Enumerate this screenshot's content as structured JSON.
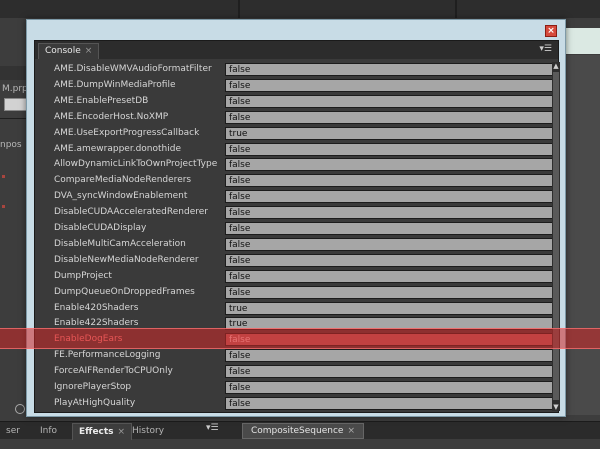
{
  "background": {
    "left_fragments": [
      "M.prp",
      "npos"
    ],
    "bottom_tabs": [
      {
        "label": "ser",
        "active": false
      },
      {
        "label": "Info",
        "active": false
      },
      {
        "label": "Effects",
        "active": true,
        "close": "×"
      },
      {
        "label": "History",
        "active": false
      }
    ],
    "bottom_menu_glyph": "▾☰",
    "sequence_tab": {
      "label": "CompositeSequence",
      "close": "×"
    }
  },
  "dialog": {
    "close_glyph": "×",
    "console": {
      "tab_label": "Console",
      "tab_close": "×",
      "menu_glyph": "▾☰",
      "rows": [
        {
          "name": "AME.DisableWMVAudioFormatFilter",
          "value": "false"
        },
        {
          "name": "AME.DumpWinMediaProfile",
          "value": "false"
        },
        {
          "name": "AME.EnablePresetDB",
          "value": "false"
        },
        {
          "name": "AME.EncoderHost.NoXMP",
          "value": "false"
        },
        {
          "name": "AME.UseExportProgressCallback",
          "value": "true"
        },
        {
          "name": "AME.amewrapper.donothide",
          "value": "false"
        },
        {
          "name": "AllowDynamicLinkToOwnProjectType",
          "value": "false"
        },
        {
          "name": "CompareMediaNodeRenderers",
          "value": "false"
        },
        {
          "name": "DVA_syncWindowEnablement",
          "value": "false"
        },
        {
          "name": "DisableCUDAAcceleratedRenderer",
          "value": "false"
        },
        {
          "name": "DisableCUDADisplay",
          "value": "false"
        },
        {
          "name": "DisableMultiCamAcceleration",
          "value": "false"
        },
        {
          "name": "DisableNewMediaNodeRenderer",
          "value": "false"
        },
        {
          "name": "DumpProject",
          "value": "false"
        },
        {
          "name": "DumpQueueOnDroppedFrames",
          "value": "false"
        },
        {
          "name": "Enable420Shaders",
          "value": "true"
        },
        {
          "name": "Enable422Shaders",
          "value": "true"
        },
        {
          "name": "EnableDogEars",
          "value": "false",
          "highlighted": true
        },
        {
          "name": "FE.PerformanceLogging",
          "value": "false"
        },
        {
          "name": "ForceAIFRenderToCPUOnly",
          "value": "false"
        },
        {
          "name": "IgnorePlayerStop",
          "value": "false"
        },
        {
          "name": "PlayAtHighQuality",
          "value": "false"
        }
      ]
    }
  },
  "colors": {
    "highlight": "#d22828",
    "dialog_frame": "#c8dce6",
    "panel_bg": "#3a3a3a",
    "value_field": "#a6a6a6"
  }
}
